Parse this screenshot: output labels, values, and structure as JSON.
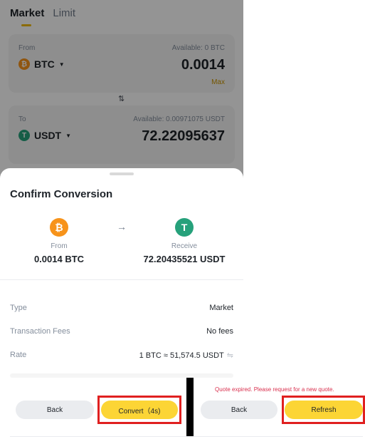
{
  "tabs": [
    {
      "label": "Market",
      "active": true
    },
    {
      "label": "Limit",
      "active": false
    }
  ],
  "from_card": {
    "label": "From",
    "available": "Available: 0 BTC",
    "asset": "BTC",
    "amount": "0.0014",
    "max_label": "Max"
  },
  "to_card": {
    "label": "To",
    "available": "Available: 0.00971075 USDT",
    "asset": "USDT",
    "amount": "72.22095637"
  },
  "sheet": {
    "title": "Confirm Conversion",
    "from_label": "From",
    "from_value": "0.0014 BTC",
    "receive_label": "Receive",
    "receive_value": "72.20435521 USDT",
    "details": [
      {
        "key": "Type",
        "value": "Market"
      },
      {
        "key": "Transaction Fees",
        "value": "No fees"
      },
      {
        "key": "Rate",
        "value": "1 BTC ≈ 51,574.5 USDT"
      }
    ]
  },
  "left_panel": {
    "back_label": "Back",
    "convert_label": "Convert（4s)"
  },
  "right_panel": {
    "expired_message": "Quote expired. Please request for a new quote.",
    "back_label": "Back",
    "refresh_label": "Refresh"
  },
  "colors": {
    "accent_yellow": "#fcd535",
    "btc_orange": "#f7931a",
    "usdt_green": "#26a17b",
    "highlight_red": "#e02020",
    "error_red": "#d9304e"
  }
}
